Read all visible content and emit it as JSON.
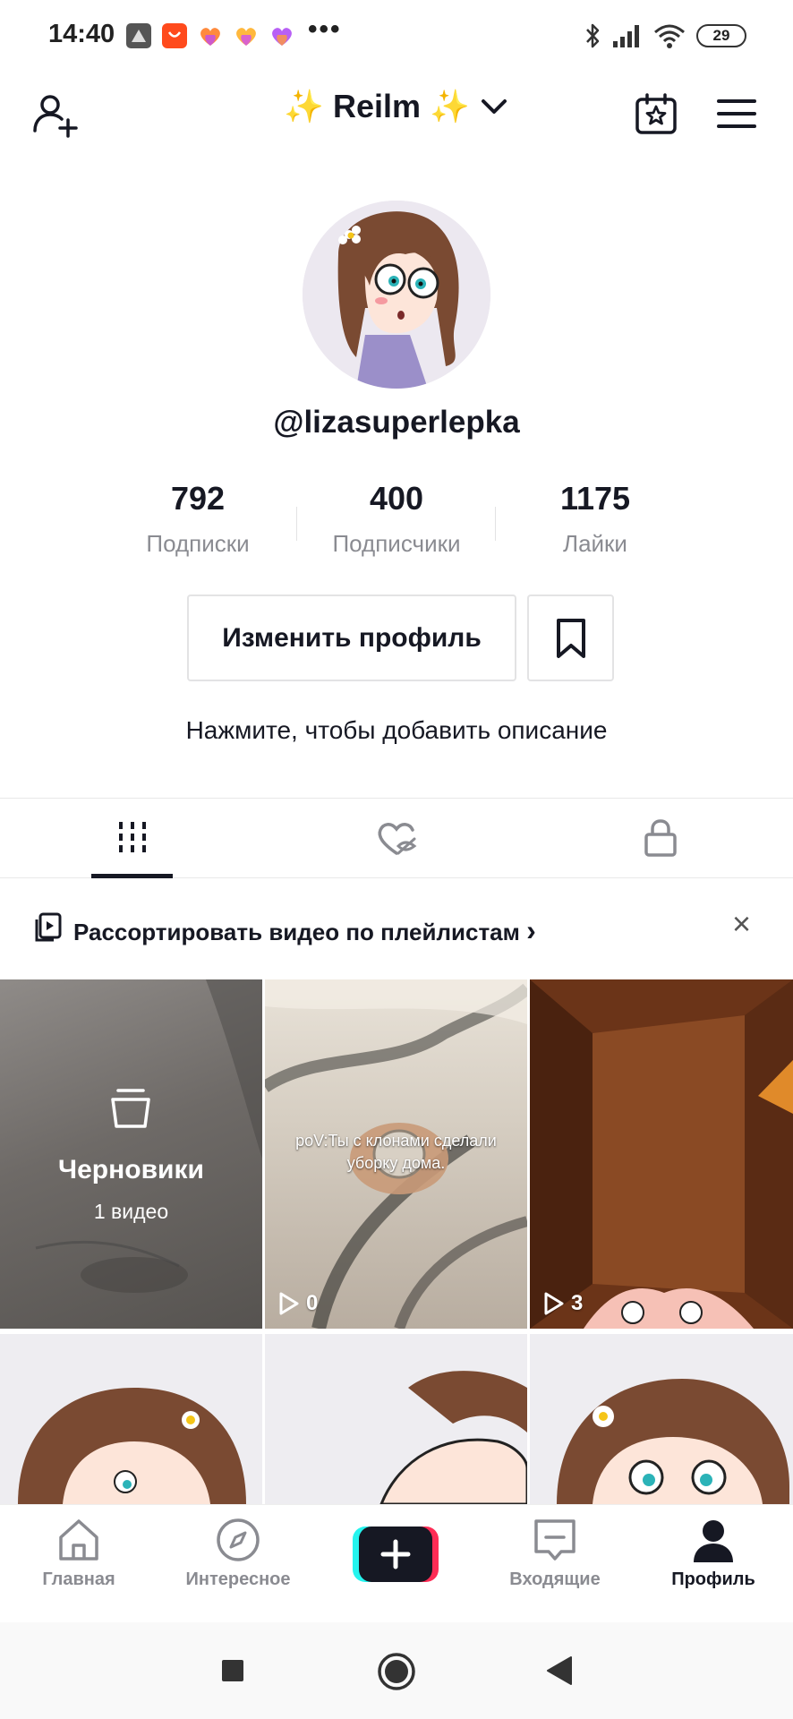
{
  "status_bar": {
    "time": "14:40",
    "battery": "29",
    "icons": [
      "bluetooth-icon",
      "signal-icon",
      "wifi-icon",
      "battery-icon"
    ],
    "app_icons": [
      "app-icon-1",
      "app-icon-aliexpress",
      "app-icon-likee-1",
      "app-icon-likee-2",
      "app-icon-likee-3"
    ],
    "more": "•••"
  },
  "header": {
    "title": "Reilm",
    "sparkle_left": "✨",
    "sparkle_right": "✨",
    "icons": [
      "add-user-icon",
      "chevron-down-icon",
      "calendar-star-icon",
      "menu-icon"
    ]
  },
  "profile": {
    "username": "@lizasuperlepka",
    "stats": [
      {
        "value": "792",
        "label": "Подписки"
      },
      {
        "value": "400",
        "label": "Подписчики"
      },
      {
        "value": "1175",
        "label": "Лайки"
      }
    ],
    "edit_button": "Изменить профиль",
    "bio_placeholder": "Нажмите, чтобы добавить описание"
  },
  "tabs": [
    {
      "icon": "grid-icon",
      "active": true
    },
    {
      "icon": "liked-hidden-icon",
      "active": false
    },
    {
      "icon": "lock-icon",
      "active": false
    }
  ],
  "banner": {
    "text": "Рассортировать видео по плейлистам",
    "chevron": "›",
    "close": "×"
  },
  "grid": {
    "drafts": {
      "title": "Черновики",
      "count": "1 видео"
    },
    "videos": [
      {
        "overlay": "poV:Ты с клонами сделали уборку дома.",
        "views": "0"
      },
      {
        "overlay": "",
        "views": "3"
      }
    ]
  },
  "bottom_nav": {
    "items": [
      {
        "label": "Главная",
        "icon": "home-icon"
      },
      {
        "label": "Интересное",
        "icon": "compass-icon"
      },
      {
        "label": "",
        "icon": "plus-icon"
      },
      {
        "label": "Входящие",
        "icon": "inbox-icon"
      },
      {
        "label": "Профиль",
        "icon": "profile-icon"
      }
    ]
  },
  "colors": {
    "text": "#161823",
    "secondary": "#8a8b91",
    "border": "#e3e3e4",
    "create_cyan": "#25f4ee",
    "create_red": "#fe2c55"
  }
}
